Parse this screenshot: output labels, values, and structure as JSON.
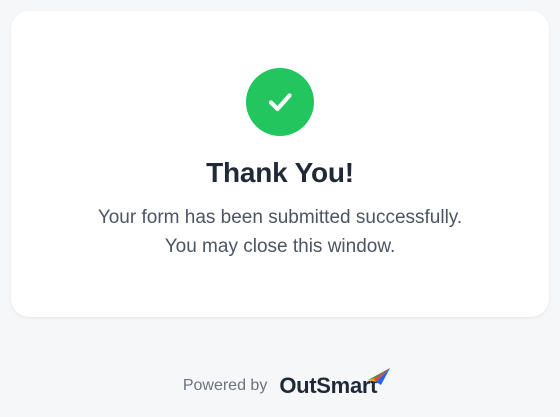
{
  "card": {
    "title": "Thank You!",
    "message_line1": "Your form has been submitted successfully.",
    "message_line2": "You may close this window."
  },
  "footer": {
    "powered_by": "Powered by",
    "brand": "OutSmart"
  },
  "colors": {
    "success": "#22c55e",
    "title": "#1f2937",
    "body_text": "#4b5563",
    "background": "#f6f7f9"
  },
  "icons": {
    "status": "checkmark-icon",
    "brand_mark": "paper-plane-icon"
  }
}
